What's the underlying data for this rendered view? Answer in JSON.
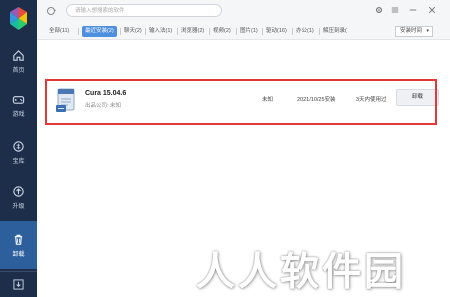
{
  "search": {
    "placeholder": "请输入想搜索的软件"
  },
  "sidebar": {
    "items": [
      {
        "label": "首页",
        "icon": "home-icon"
      },
      {
        "label": "游戏",
        "icon": "gamepad-icon"
      },
      {
        "label": "宝库",
        "icon": "treasure-icon"
      },
      {
        "label": "升级",
        "icon": "upgrade-icon"
      },
      {
        "label": "卸载",
        "icon": "trash-icon"
      }
    ]
  },
  "tabs": [
    {
      "label": "全部(11)"
    },
    {
      "label": "最近安装(2)"
    },
    {
      "label": "聊天(2)"
    },
    {
      "label": "输入法(1)"
    },
    {
      "label": "浏览器(2)"
    },
    {
      "label": "视频(2)"
    },
    {
      "label": "图片(1)"
    },
    {
      "label": "驱动(16)"
    },
    {
      "label": "办公(1)"
    },
    {
      "label": "解压刻录("
    }
  ],
  "sort": {
    "selected": "安装时间"
  },
  "apps": [
    {
      "name": "Cura 15.04.6",
      "publisher": "出品公司: 未知",
      "size": "未知",
      "date": "2021/10/25安装",
      "usage": "3天内使用过",
      "action": "卸载"
    }
  ],
  "watermark": "人人软件园",
  "colors": {
    "sidebar": "#1d2e4a",
    "active_nav": "#2e5f9d",
    "active_tab": "#4f8fe0",
    "highlight_border": "#e5373a"
  }
}
